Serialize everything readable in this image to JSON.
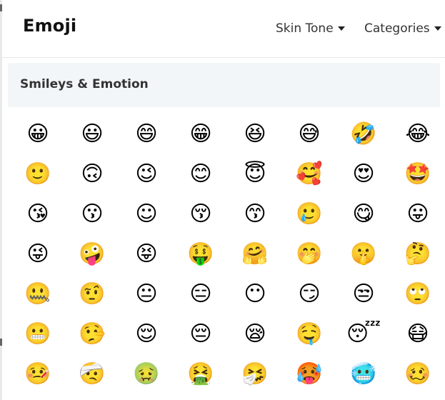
{
  "app": {
    "title": "Emoji"
  },
  "header": {
    "skin_tone_label": "Skin Tone",
    "categories_label": "Categories"
  },
  "section": {
    "title": "Smileys & Emotion"
  },
  "emojis": [
    [
      "😀",
      "😃",
      "😄",
      "😁",
      "😆",
      "😅",
      "🤣",
      "😂"
    ],
    [
      "🙂",
      "🙃",
      "😉",
      "😊",
      "😇",
      "🥰",
      "😍",
      "🤩"
    ],
    [
      "😘",
      "😗",
      "☺",
      "😚",
      "😙",
      "🥲",
      "😋",
      "😛"
    ],
    [
      "😜",
      "🤪",
      "😝",
      "🤑",
      "🤗",
      "🤭",
      "🤫",
      "🤔"
    ],
    [
      "🤐",
      "🤨",
      "😐",
      "😑",
      "😶",
      "😏",
      "😒",
      "🙄"
    ],
    [
      "😬",
      "🤥",
      "😌",
      "😔",
      "😪",
      "🤤",
      "😴",
      "😷"
    ],
    [
      "🤒",
      "🤕",
      "🤢",
      "🤮",
      "🤧",
      "🥵",
      "🥶",
      "🥴"
    ]
  ],
  "colors": {
    "section_bg": "#f3f6f9",
    "divider": "#e6e6e6"
  }
}
